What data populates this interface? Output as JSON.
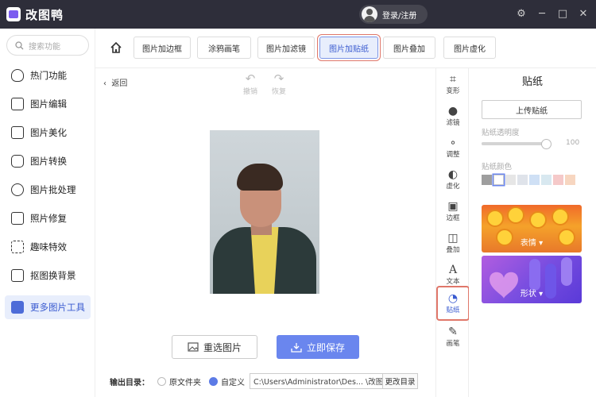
{
  "app": {
    "name": "改图鸭",
    "login": "登录/注册",
    "win_controls": [
      "⚙",
      "─",
      "□",
      "✕"
    ]
  },
  "sidebar": {
    "search_placeholder": "搜索功能",
    "items": [
      {
        "label": "热门功能",
        "icon": "flame-icon"
      },
      {
        "label": "图片编辑",
        "icon": "image-edit-icon"
      },
      {
        "label": "图片美化",
        "icon": "image-beautify-icon"
      },
      {
        "label": "图片转换",
        "icon": "image-convert-icon"
      },
      {
        "label": "图片批处理",
        "icon": "batch-icon"
      },
      {
        "label": "照片修复",
        "icon": "photo-repair-icon"
      },
      {
        "label": "趣味特效",
        "icon": "sparkle-icon"
      },
      {
        "label": "抠图换背景",
        "icon": "cutout-icon"
      },
      {
        "label": "更多图片工具",
        "icon": "toolbox-icon"
      }
    ]
  },
  "toolbar": {
    "tabs": [
      "图片加边框",
      "涂鸦画笔",
      "图片加滤镜",
      "图片加贴纸",
      "图片叠加",
      "图片虚化"
    ],
    "active_tab": "图片加贴纸"
  },
  "canvas": {
    "back": "返回",
    "undo": "撤销",
    "redo": "恢复"
  },
  "actions": {
    "reselect": "重选图片",
    "save": "立即保存"
  },
  "output": {
    "label": "输出目录：",
    "opt_original": "原文件夹",
    "opt_custom": "自定义",
    "path": "C:\\Users\\Administrator\\Des... \\改图鸭",
    "change": "更改目录"
  },
  "tools": [
    {
      "label": "变形",
      "icon": "crop-icon"
    },
    {
      "label": "滤镜",
      "icon": "filter-icon"
    },
    {
      "label": "调整",
      "icon": "adjust-icon"
    },
    {
      "label": "虚化",
      "icon": "blur-icon"
    },
    {
      "label": "边框",
      "icon": "border-icon"
    },
    {
      "label": "叠加",
      "icon": "overlay-icon"
    },
    {
      "label": "文本",
      "icon": "text-icon"
    },
    {
      "label": "贴纸",
      "icon": "sticker-icon"
    },
    {
      "label": "画笔",
      "icon": "brush-icon"
    }
  ],
  "panel": {
    "title": "贴纸",
    "upload": "上传贴纸",
    "opacity_label": "贴纸透明度",
    "opacity_value": "100",
    "opacity_level": 1.0,
    "color_label": "贴纸颜色",
    "swatches": [
      "#9e9e9e",
      "#ffffff",
      "#e6e6e6",
      "#dfe3ea",
      "#cfe0f5",
      "#d8e8f0",
      "#f5c9c9",
      "#f7d6c0"
    ],
    "cards": [
      {
        "label": "表情 ▾"
      },
      {
        "label": "形状 ▾"
      }
    ]
  },
  "colors": {
    "accent": "#6a86ee",
    "highlight": "#e0776a",
    "titlebar": "#2e2e3a"
  }
}
